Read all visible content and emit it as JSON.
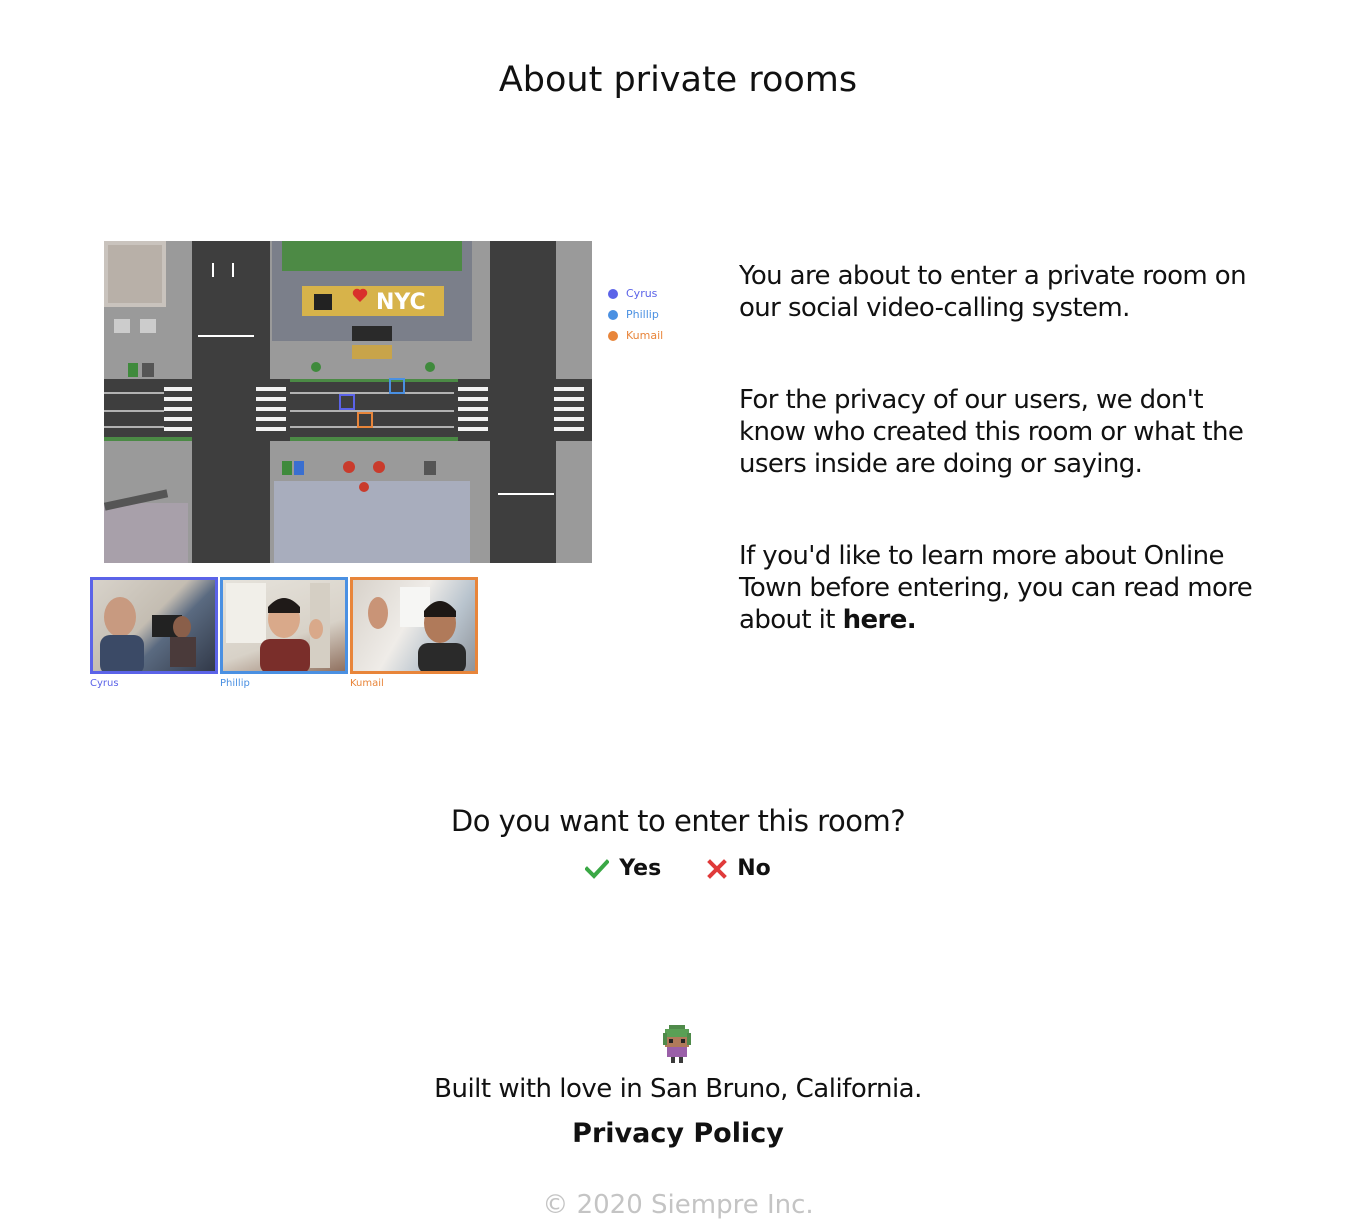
{
  "title": "About private rooms",
  "illustration": {
    "banner_text": "NYC",
    "legend": [
      {
        "name": "Cyrus",
        "color": "#5b63e8"
      },
      {
        "name": "Phillip",
        "color": "#4a90e2"
      },
      {
        "name": "Kumail",
        "color": "#e8853a"
      }
    ],
    "videos": [
      {
        "label": "Cyrus",
        "color": "#5b63e8"
      },
      {
        "label": "Phillip",
        "color": "#4a90e2"
      },
      {
        "label": "Kumail",
        "color": "#e8853a"
      }
    ]
  },
  "info": {
    "paragraph1": "You are about to enter a private room on our social video-calling system.",
    "paragraph2": "For the privacy of our users, we don't know who created this room or what the users inside are doing or saying.",
    "paragraph3_prefix": "If you'd like to learn more about Online Town before entering, you can read more about it ",
    "paragraph3_link": "here."
  },
  "question": "Do you want to enter this room?",
  "choices": {
    "yes": {
      "label": "Yes",
      "icon": "checkmark-icon",
      "color": "#3aa845"
    },
    "no": {
      "label": "No",
      "icon": "x-icon",
      "color": "#e03a3a"
    }
  },
  "footer": {
    "built_with": "Built with love in San Bruno, California.",
    "privacy": "Privacy Policy",
    "copyright": "© 2020 Siempre Inc."
  }
}
